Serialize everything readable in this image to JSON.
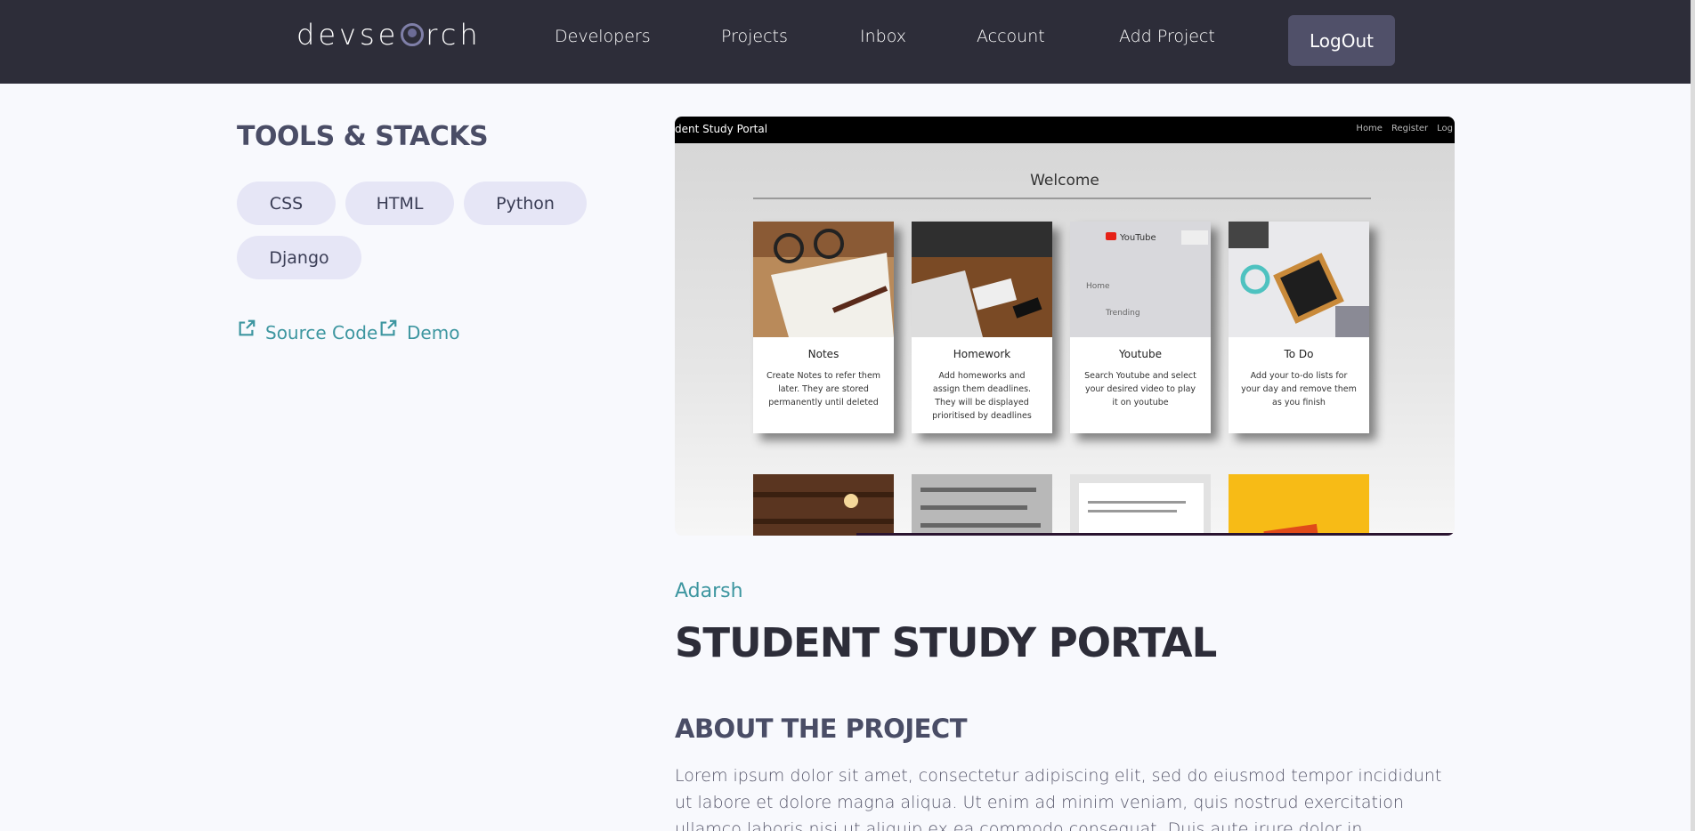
{
  "header": {
    "logo_text_before": "devse",
    "logo_text_after": "rch",
    "logo_lens_letter": "a",
    "nav": [
      "Developers",
      "Projects",
      "Inbox",
      "Account",
      "Add Project"
    ],
    "logout_label": "LogOut"
  },
  "sidebar": {
    "tools_title": "TOOLS & STACKS",
    "tags": [
      "CSS",
      "HTML",
      "Python",
      "Django"
    ],
    "links": {
      "source_code": "Source Code",
      "demo": "Demo"
    }
  },
  "project_image": {
    "brand": "dent Study Portal",
    "nav_links": [
      "Home",
      "Register",
      "Log"
    ],
    "welcome": "Welcome",
    "cards": [
      {
        "title": "Notes",
        "desc": "Create Notes to refer them later. They are stored permanently until deleted"
      },
      {
        "title": "Homework",
        "desc": "Add homeworks and assign them deadlines. They will be displayed prioritised by deadlines"
      },
      {
        "title": "Youtube",
        "desc": "Search Youtube and select your desired video to play it on youtube"
      },
      {
        "title": "To Do",
        "desc": "Add your to-do lists for your day and remove them as you finish"
      }
    ]
  },
  "project": {
    "owner": "Adarsh",
    "title": "STUDENT STUDY PORTAL",
    "about_title": "ABOUT THE PROJECT",
    "about_text": "Lorem ipsum dolor sit amet, consectetur adipiscing elit, sed do eiusmod tempor incididunt ut labore et dolore magna aliqua. Ut enim ad minim veniam, quis nostrud exercitation ullamco laboris nisi ut aliquip ex ea commodo consequat. Duis aute irure dolor in"
  },
  "colors": {
    "header_bg": "#2d2d39",
    "accent": "#3d96a0",
    "tag_bg": "#e6e6f6",
    "page_bg": "#f8f9fd"
  },
  "icons": [
    "external-link-icon",
    "search-lens-icon"
  ]
}
